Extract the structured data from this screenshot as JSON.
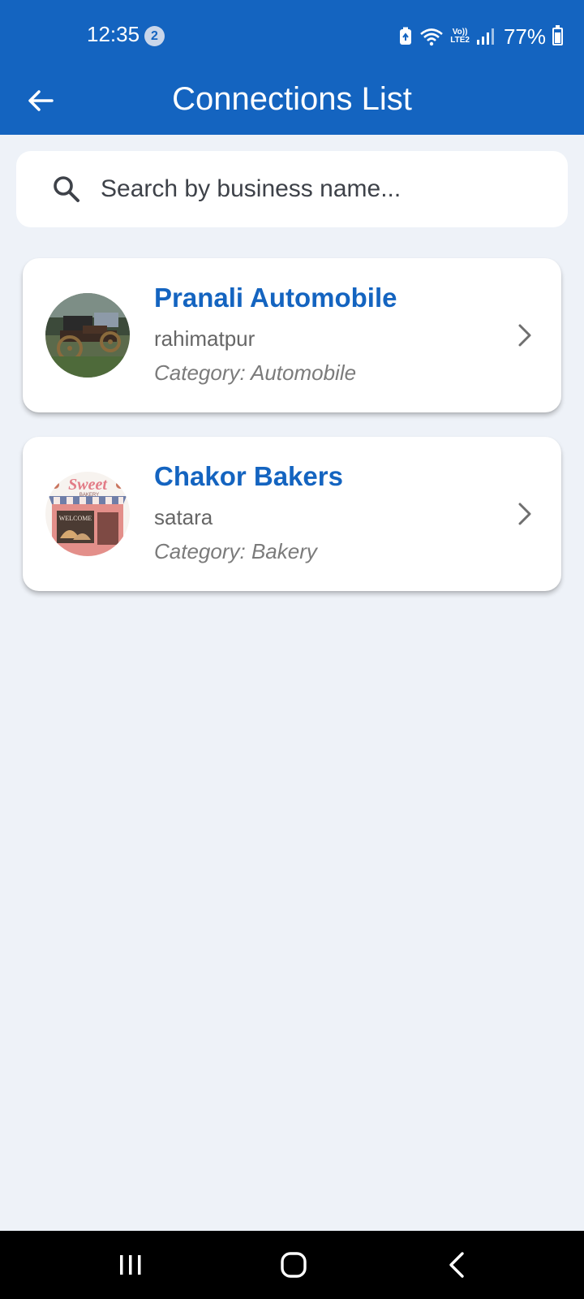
{
  "status_bar": {
    "time": "12:35",
    "notification_count": "2",
    "volte_top": "Vo))",
    "volte_bottom": "LTE2",
    "battery_percent": "77%"
  },
  "app_bar": {
    "title": "Connections List",
    "background_color": "#1464c0"
  },
  "search": {
    "placeholder": "Search by business name..."
  },
  "connections": [
    {
      "name": "Pranali Automobile",
      "city": "rahimatpur",
      "category": "Category: Automobile",
      "avatar": "vintage-car-photo"
    },
    {
      "name": "Chakor Bakers",
      "city": "satara",
      "category": "Category: Bakery",
      "avatar": "sweet-bakery-storefront"
    }
  ],
  "bakery_sign": {
    "word": "Sweet",
    "sub": "BAKERY",
    "door": "WELCOME"
  },
  "nav": [
    "recent-apps",
    "home",
    "back"
  ]
}
